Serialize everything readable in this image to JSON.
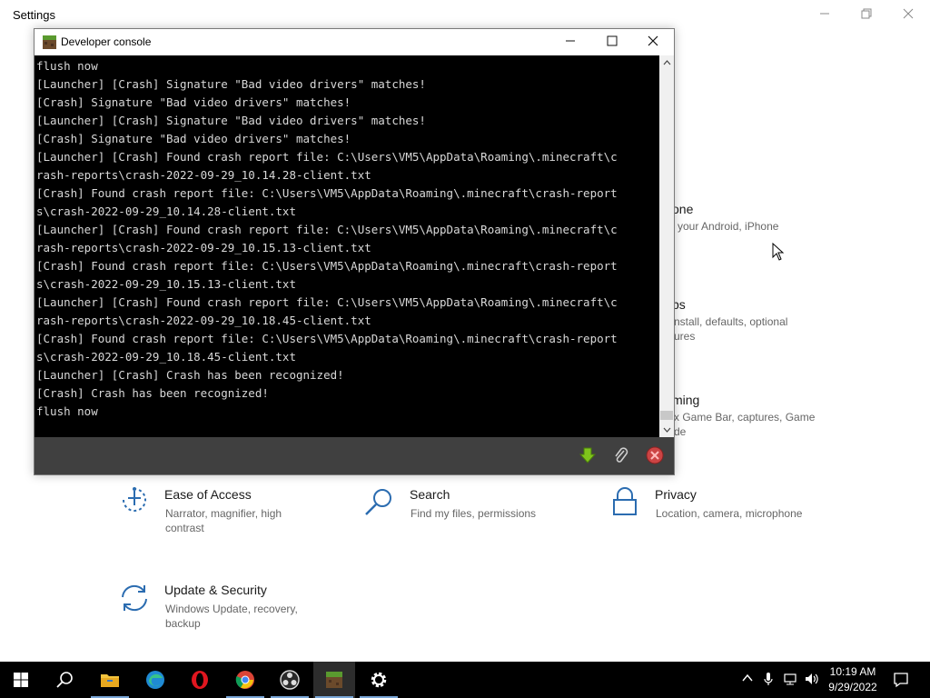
{
  "settings": {
    "title": "Settings",
    "tiles": [
      {
        "id": "ease",
        "name": "Ease of Access",
        "desc": "Narrator, magnifier, high contrast",
        "icon": "ease-of-access-icon"
      },
      {
        "id": "search",
        "name": "Search",
        "desc": "Find my files, permissions",
        "icon": "search-icon"
      },
      {
        "id": "privacy",
        "name": "Privacy",
        "desc": "Location, camera, microphone",
        "icon": "lock-icon"
      },
      {
        "id": "update",
        "name": "Update & Security",
        "desc": "Windows Update, recovery, backup",
        "icon": "sync-icon"
      }
    ],
    "partial": {
      "phone_name": "one",
      "phone_desc": "your Android, iPhone",
      "apps_name": "ps",
      "apps_desc1": "nstall, defaults, optional",
      "apps_desc2": "ures",
      "gaming_name": "ming",
      "gaming_desc1": "x Game Bar, captures, Game",
      "gaming_desc2": "de"
    }
  },
  "console": {
    "title": "Developer console",
    "lines": [
      "flush now",
      "[Launcher] [Crash] Signature \"Bad video drivers\" matches!",
      "[Crash] Signature \"Bad video drivers\" matches!",
      "[Launcher] [Crash] Signature \"Bad video drivers\" matches!",
      "[Crash] Signature \"Bad video drivers\" matches!",
      "[Launcher] [Crash] Found crash report file: C:\\Users\\VM5\\AppData\\Roaming\\.minecraft\\c",
      "rash-reports\\crash-2022-09-29_10.14.28-client.txt",
      "[Crash] Found crash report file: C:\\Users\\VM5\\AppData\\Roaming\\.minecraft\\crash-report",
      "s\\crash-2022-09-29_10.14.28-client.txt",
      "[Launcher] [Crash] Found crash report file: C:\\Users\\VM5\\AppData\\Roaming\\.minecraft\\c",
      "rash-reports\\crash-2022-09-29_10.15.13-client.txt",
      "[Crash] Found crash report file: C:\\Users\\VM5\\AppData\\Roaming\\.minecraft\\crash-report",
      "s\\crash-2022-09-29_10.15.13-client.txt",
      "[Launcher] [Crash] Found crash report file: C:\\Users\\VM5\\AppData\\Roaming\\.minecraft\\c",
      "rash-reports\\crash-2022-09-29_10.18.45-client.txt",
      "[Crash] Found crash report file: C:\\Users\\VM5\\AppData\\Roaming\\.minecraft\\crash-report",
      "s\\crash-2022-09-29_10.18.45-client.txt",
      "[Launcher] [Crash] Crash has been recognized!",
      "[Crash] Crash has been recognized!",
      "flush now"
    ]
  },
  "taskbar": {
    "time": "10:19 AM",
    "date": "9/29/2022"
  },
  "colors": {
    "taskbar_bg": "#000000",
    "console_bg": "#000000",
    "console_text": "#d8d8d8",
    "settings_accent": "#2b6cb0"
  }
}
